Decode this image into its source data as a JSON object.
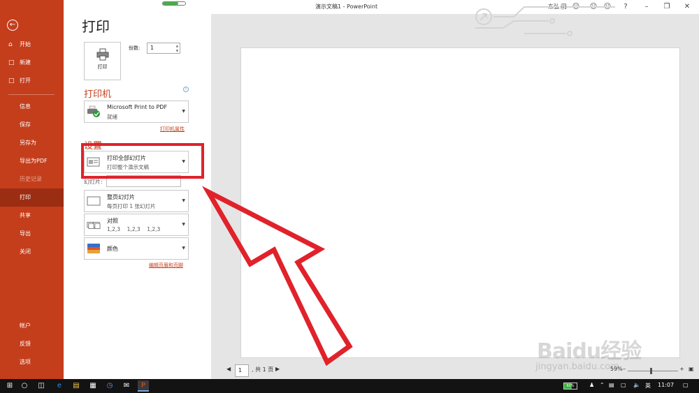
{
  "window": {
    "title": "演示文稿1 - PowerPoint",
    "user": "东弘 同",
    "help": "?"
  },
  "sidebar": {
    "back_icon": "back-arrow-icon",
    "top_items": [
      {
        "label": "开始",
        "icon": "home-icon"
      },
      {
        "label": "新建",
        "icon": "new-file-icon"
      },
      {
        "label": "打开",
        "icon": "open-folder-icon"
      }
    ],
    "mid_items": [
      {
        "label": "信息"
      },
      {
        "label": "保存"
      },
      {
        "label": "另存为"
      },
      {
        "label": "导出为PDF"
      },
      {
        "label": "历史记录"
      },
      {
        "label": "打印"
      },
      {
        "label": "共享"
      },
      {
        "label": "导出"
      },
      {
        "label": "关闭"
      }
    ],
    "bottom_items": [
      {
        "label": "帐户"
      },
      {
        "label": "反馈"
      },
      {
        "label": "选项"
      }
    ]
  },
  "print": {
    "title": "打印",
    "print_button_label": "打印",
    "copies_label": "份数:",
    "copies_value": "1",
    "printer_section": "打印机",
    "printer_name": "Microsoft Print to PDF",
    "printer_status": "就绪",
    "printer_props_link": "打印机属性",
    "settings_section": "设置",
    "slides_range_main": "打印全部幻灯片",
    "slides_range_sub": "打印整个演示文稿",
    "slides_label": "幻灯片:",
    "layout_main": "整页幻灯片",
    "layout_sub": "每页打印 1 张幻灯片",
    "collate_main": "对照",
    "collate_sub": "1,2,3    1,2,3    1,2,3",
    "color_main": "颜色",
    "header_footer_link": "编辑页眉和页脚"
  },
  "preview": {
    "page_value": "1",
    "page_total": ", 共 1 页",
    "zoom": "59%"
  },
  "watermark": {
    "main": "Baidu经验",
    "sub": "jingyan.baidu.com"
  },
  "taskbar": {
    "battery": "60%",
    "ime": "英",
    "time": "11:07"
  }
}
